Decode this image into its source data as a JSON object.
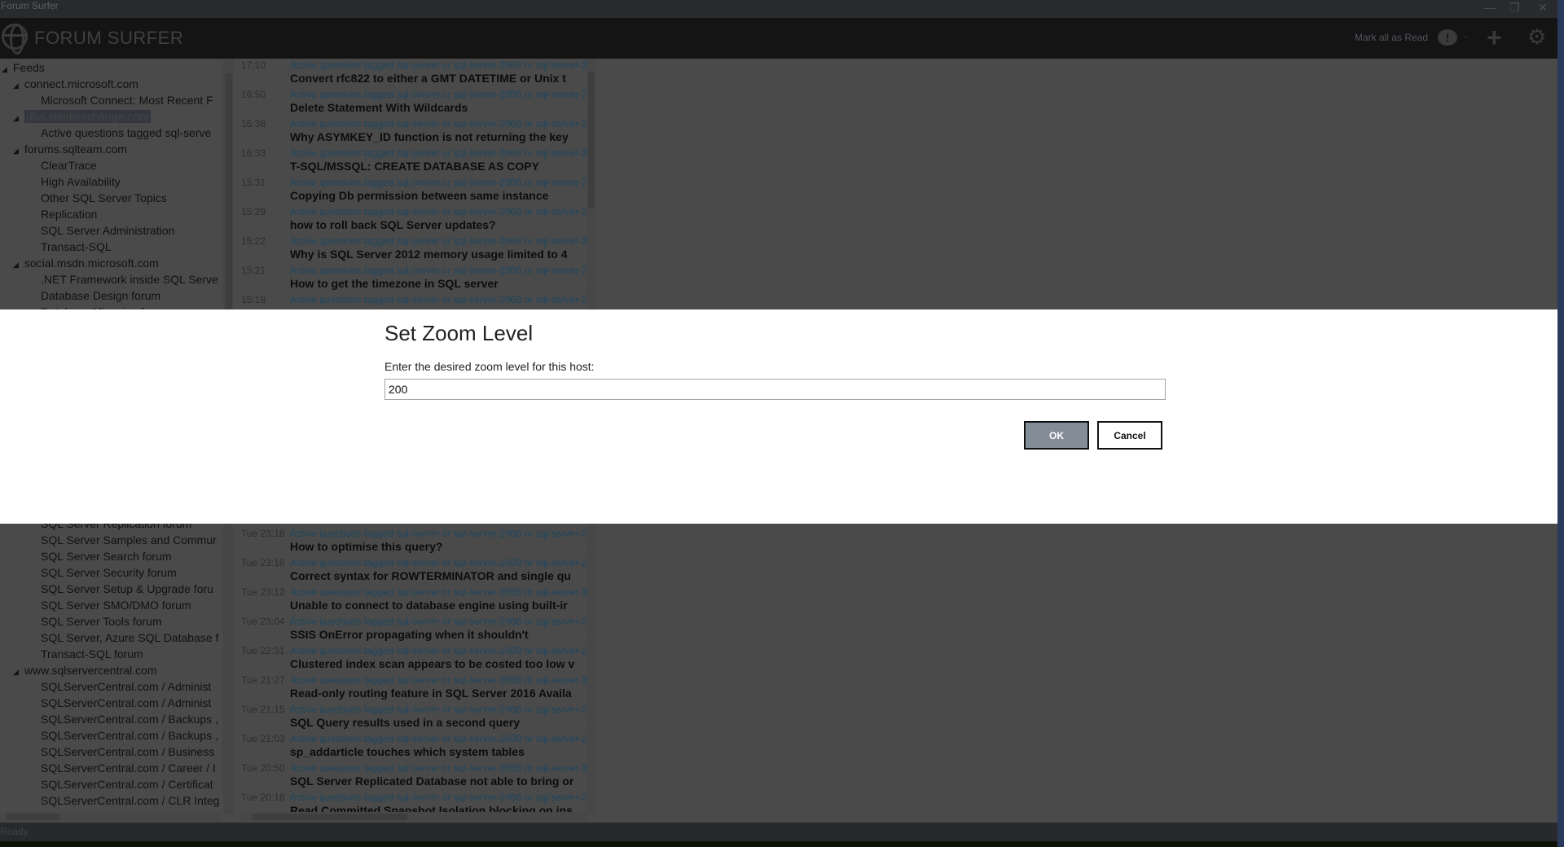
{
  "window": {
    "title": "Forum Surfer"
  },
  "header": {
    "app_title": "FORUM SURFER",
    "mark_all_read": "Mark all as Read"
  },
  "tree_top": [
    {
      "label": "Feeds",
      "level": 0,
      "expander": true
    },
    {
      "label": "connect.microsoft.com",
      "level": 1,
      "expander": true
    },
    {
      "label": "Microsoft Connect: Most Recent F",
      "level": 2
    },
    {
      "label": "dba.stackexchange.com",
      "level": 1,
      "expander": true,
      "selected": true
    },
    {
      "label": "Active questions tagged sql-serve",
      "level": 2
    },
    {
      "label": "forums.sqlteam.com",
      "level": 1,
      "expander": true
    },
    {
      "label": "ClearTrace",
      "level": 2
    },
    {
      "label": "High Availability",
      "level": 2
    },
    {
      "label": "Other SQL Server Topics",
      "level": 2
    },
    {
      "label": "Replication",
      "level": 2
    },
    {
      "label": "SQL Server Administration",
      "level": 2
    },
    {
      "label": "Transact-SQL",
      "level": 2
    },
    {
      "label": "social.msdn.microsoft.com",
      "level": 1,
      "expander": true
    },
    {
      "label": ".NET Framework inside SQL Serve",
      "level": 2
    },
    {
      "label": "Database Design forum",
      "level": 2
    },
    {
      "label": "Database Mirroring f",
      "level": 2
    }
  ],
  "tree_bottom": [
    {
      "label": "SQL Server Replication forum",
      "level": 2
    },
    {
      "label": "SQL Server Samples and Commur",
      "level": 2
    },
    {
      "label": "SQL Server Search forum",
      "level": 2
    },
    {
      "label": "SQL Server Security forum",
      "level": 2
    },
    {
      "label": "SQL Server Setup & Upgrade foru",
      "level": 2
    },
    {
      "label": "SQL Server SMO/DMO forum",
      "level": 2
    },
    {
      "label": "SQL Server Tools forum",
      "level": 2
    },
    {
      "label": "SQL Server, Azure SQL Database f",
      "level": 2
    },
    {
      "label": "Transact-SQL forum",
      "level": 2
    },
    {
      "label": "www.sqlservercentral.com",
      "level": 1,
      "expander": true
    },
    {
      "label": "SQLServerCentral.com / Administ",
      "level": 2
    },
    {
      "label": "SQLServerCentral.com / Administ",
      "level": 2
    },
    {
      "label": "SQLServerCentral.com / Backups ,",
      "level": 2
    },
    {
      "label": "SQLServerCentral.com / Backups ,",
      "level": 2
    },
    {
      "label": "SQLServerCentral.com / Business",
      "level": 2
    },
    {
      "label": "SQLServerCentral.com / Career / I",
      "level": 2
    },
    {
      "label": "SQLServerCentral.com / Certificat",
      "level": 2
    },
    {
      "label": "SQLServerCentral.com / CLR Integ",
      "level": 2
    }
  ],
  "feed_meta": "Active questions tagged sql-server or sql-server-2008 or sql-server-2",
  "posts_top": [
    {
      "time": "17:10",
      "title": "Convert rfc822 to either a GMT DATETIME or Unix t"
    },
    {
      "time": "16:50",
      "title": "Delete Statement With Wildcards"
    },
    {
      "time": "16:38",
      "title": "Why ASYMKEY_ID function is not returning the key"
    },
    {
      "time": "16:33",
      "title": "T-SQL/MSSQL: CREATE DATABASE AS COPY"
    },
    {
      "time": "15:31",
      "title": "Copying Db permission between same instance"
    },
    {
      "time": "15:29",
      "title": "how to roll back SQL Server updates?"
    },
    {
      "time": "15:22",
      "title": "Why is SQL Server 2012 memory usage limited to 4"
    },
    {
      "time": "15:21",
      "title": "How to get the timezone in SQL server"
    },
    {
      "time": "15:18",
      "title": ""
    }
  ],
  "posts_bottom": [
    {
      "time": "Tue 23:18",
      "title": "How to optimise this query?"
    },
    {
      "time": "Tue 23:16",
      "title": "Correct syntax for ROWTERMINATOR and single qu"
    },
    {
      "time": "Tue 23:12",
      "title": "Unable to connect to database engine using built-ir"
    },
    {
      "time": "Tue 23:04",
      "title": "SSIS OnError propagating when it shouldn't"
    },
    {
      "time": "Tue 22:31",
      "title": "Clustered index scan appears to be costed too low v"
    },
    {
      "time": "Tue 21:27",
      "title": "Read-only routing feature in SQL Server 2016 Availa"
    },
    {
      "time": "Tue 21:15",
      "title": "SQL Query results used in a second query"
    },
    {
      "time": "Tue 21:03",
      "title": "sp_addarticle touches which system tables"
    },
    {
      "time": "Tue 20:50",
      "title": "SQL Server Replicated Database not able to bring or"
    },
    {
      "time": "Tue 20:18",
      "title": "Read Committed Snapshot Isolation blocking on ins"
    }
  ],
  "status": {
    "text": "Ready"
  },
  "dialog": {
    "title": "Set Zoom Level",
    "label": "Enter the desired zoom level for this host:",
    "value": "200",
    "ok": "OK",
    "cancel": "Cancel"
  }
}
